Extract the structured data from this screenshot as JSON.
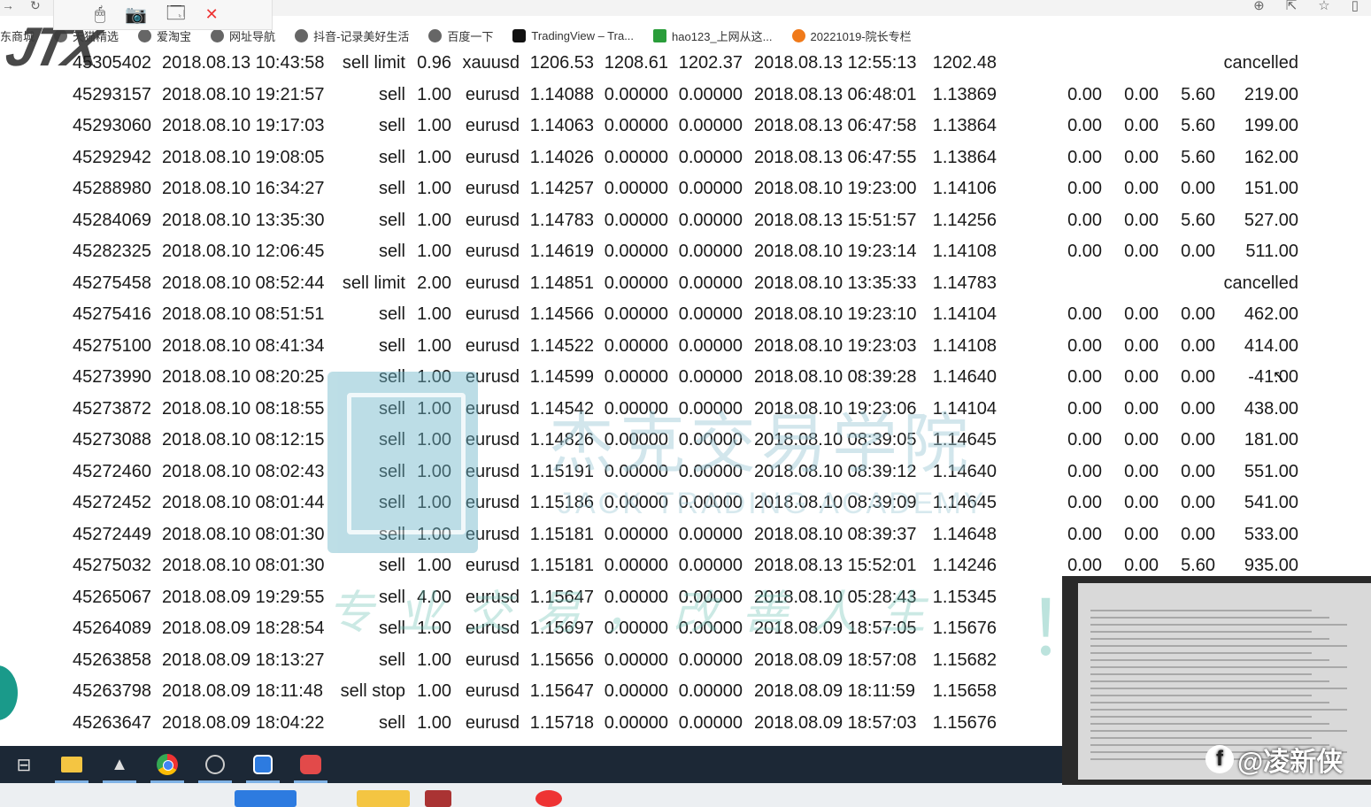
{
  "browser": {
    "bookmarks": [
      {
        "label": "东商城",
        "icon": "none"
      },
      {
        "label": "天猫精选",
        "icon": "globe-icon"
      },
      {
        "label": "爱淘宝",
        "icon": "globe-icon"
      },
      {
        "label": "网址导航",
        "icon": "globe-icon"
      },
      {
        "label": "抖音-记录美好生活",
        "icon": "globe-icon"
      },
      {
        "label": "百度一下",
        "icon": "globe-icon"
      },
      {
        "label": "TradingView – Tra...",
        "icon": "tradingview-icon"
      },
      {
        "label": "hao123_上网从这...",
        "icon": "hao123-icon"
      },
      {
        "label": "20221019-院长专栏",
        "icon": "orange-globe-icon"
      }
    ],
    "toolbar_close": "✕"
  },
  "logo": {
    "text": "JTX"
  },
  "table": {
    "rows": [
      {
        "ticket": "45305402",
        "open_time": "2018.08.13 10:43:58",
        "type": "sell limit",
        "size": "0.96",
        "item": "xauusd",
        "price": "1206.53",
        "sl": "1208.61",
        "tp": "1202.37",
        "close_time": "2018.08.13 12:55:13",
        "close_price": "1202.48",
        "commission": "",
        "taxes": "",
        "swap": "",
        "profit": "cancelled"
      },
      {
        "ticket": "45293157",
        "open_time": "2018.08.10 19:21:57",
        "type": "sell",
        "size": "1.00",
        "item": "eurusd",
        "price": "1.14088",
        "sl": "0.00000",
        "tp": "0.00000",
        "close_time": "2018.08.13 06:48:01",
        "close_price": "1.13869",
        "commission": "0.00",
        "taxes": "0.00",
        "swap": "5.60",
        "profit": "219.00"
      },
      {
        "ticket": "45293060",
        "open_time": "2018.08.10 19:17:03",
        "type": "sell",
        "size": "1.00",
        "item": "eurusd",
        "price": "1.14063",
        "sl": "0.00000",
        "tp": "0.00000",
        "close_time": "2018.08.13 06:47:58",
        "close_price": "1.13864",
        "commission": "0.00",
        "taxes": "0.00",
        "swap": "5.60",
        "profit": "199.00"
      },
      {
        "ticket": "45292942",
        "open_time": "2018.08.10 19:08:05",
        "type": "sell",
        "size": "1.00",
        "item": "eurusd",
        "price": "1.14026",
        "sl": "0.00000",
        "tp": "0.00000",
        "close_time": "2018.08.13 06:47:55",
        "close_price": "1.13864",
        "commission": "0.00",
        "taxes": "0.00",
        "swap": "5.60",
        "profit": "162.00"
      },
      {
        "ticket": "45288980",
        "open_time": "2018.08.10 16:34:27",
        "type": "sell",
        "size": "1.00",
        "item": "eurusd",
        "price": "1.14257",
        "sl": "0.00000",
        "tp": "0.00000",
        "close_time": "2018.08.10 19:23:00",
        "close_price": "1.14106",
        "commission": "0.00",
        "taxes": "0.00",
        "swap": "0.00",
        "profit": "151.00"
      },
      {
        "ticket": "45284069",
        "open_time": "2018.08.10 13:35:30",
        "type": "sell",
        "size": "1.00",
        "item": "eurusd",
        "price": "1.14783",
        "sl": "0.00000",
        "tp": "0.00000",
        "close_time": "2018.08.13 15:51:57",
        "close_price": "1.14256",
        "commission": "0.00",
        "taxes": "0.00",
        "swap": "5.60",
        "profit": "527.00"
      },
      {
        "ticket": "45282325",
        "open_time": "2018.08.10 12:06:45",
        "type": "sell",
        "size": "1.00",
        "item": "eurusd",
        "price": "1.14619",
        "sl": "0.00000",
        "tp": "0.00000",
        "close_time": "2018.08.10 19:23:14",
        "close_price": "1.14108",
        "commission": "0.00",
        "taxes": "0.00",
        "swap": "0.00",
        "profit": "511.00"
      },
      {
        "ticket": "45275458",
        "open_time": "2018.08.10 08:52:44",
        "type": "sell limit",
        "size": "2.00",
        "item": "eurusd",
        "price": "1.14851",
        "sl": "0.00000",
        "tp": "0.00000",
        "close_time": "2018.08.10 13:35:33",
        "close_price": "1.14783",
        "commission": "",
        "taxes": "",
        "swap": "",
        "profit": "cancelled"
      },
      {
        "ticket": "45275416",
        "open_time": "2018.08.10 08:51:51",
        "type": "sell",
        "size": "1.00",
        "item": "eurusd",
        "price": "1.14566",
        "sl": "0.00000",
        "tp": "0.00000",
        "close_time": "2018.08.10 19:23:10",
        "close_price": "1.14104",
        "commission": "0.00",
        "taxes": "0.00",
        "swap": "0.00",
        "profit": "462.00"
      },
      {
        "ticket": "45275100",
        "open_time": "2018.08.10 08:41:34",
        "type": "sell",
        "size": "1.00",
        "item": "eurusd",
        "price": "1.14522",
        "sl": "0.00000",
        "tp": "0.00000",
        "close_time": "2018.08.10 19:23:03",
        "close_price": "1.14108",
        "commission": "0.00",
        "taxes": "0.00",
        "swap": "0.00",
        "profit": "414.00"
      },
      {
        "ticket": "45273990",
        "open_time": "2018.08.10 08:20:25",
        "type": "sell",
        "size": "1.00",
        "item": "eurusd",
        "price": "1.14599",
        "sl": "0.00000",
        "tp": "0.00000",
        "close_time": "2018.08.10 08:39:28",
        "close_price": "1.14640",
        "commission": "0.00",
        "taxes": "0.00",
        "swap": "0.00",
        "profit": "-41.00"
      },
      {
        "ticket": "45273872",
        "open_time": "2018.08.10 08:18:55",
        "type": "sell",
        "size": "1.00",
        "item": "eurusd",
        "price": "1.14542",
        "sl": "0.00000",
        "tp": "0.00000",
        "close_time": "2018.08.10 19:23:06",
        "close_price": "1.14104",
        "commission": "0.00",
        "taxes": "0.00",
        "swap": "0.00",
        "profit": "438.00"
      },
      {
        "ticket": "45273088",
        "open_time": "2018.08.10 08:12:15",
        "type": "sell",
        "size": "1.00",
        "item": "eurusd",
        "price": "1.14826",
        "sl": "0.00000",
        "tp": "0.00000",
        "close_time": "2018.08.10 08:39:05",
        "close_price": "1.14645",
        "commission": "0.00",
        "taxes": "0.00",
        "swap": "0.00",
        "profit": "181.00"
      },
      {
        "ticket": "45272460",
        "open_time": "2018.08.10 08:02:43",
        "type": "sell",
        "size": "1.00",
        "item": "eurusd",
        "price": "1.15191",
        "sl": "0.00000",
        "tp": "0.00000",
        "close_time": "2018.08.10 08:39:12",
        "close_price": "1.14640",
        "commission": "0.00",
        "taxes": "0.00",
        "swap": "0.00",
        "profit": "551.00"
      },
      {
        "ticket": "45272452",
        "open_time": "2018.08.10 08:01:44",
        "type": "sell",
        "size": "1.00",
        "item": "eurusd",
        "price": "1.15186",
        "sl": "0.00000",
        "tp": "0.00000",
        "close_time": "2018.08.10 08:39:09",
        "close_price": "1.14645",
        "commission": "0.00",
        "taxes": "0.00",
        "swap": "0.00",
        "profit": "541.00"
      },
      {
        "ticket": "45272449",
        "open_time": "2018.08.10 08:01:30",
        "type": "sell",
        "size": "1.00",
        "item": "eurusd",
        "price": "1.15181",
        "sl": "0.00000",
        "tp": "0.00000",
        "close_time": "2018.08.10 08:39:37",
        "close_price": "1.14648",
        "commission": "0.00",
        "taxes": "0.00",
        "swap": "0.00",
        "profit": "533.00"
      },
      {
        "ticket": "45275032",
        "open_time": "2018.08.10 08:01:30",
        "type": "sell",
        "size": "1.00",
        "item": "eurusd",
        "price": "1.15181",
        "sl": "0.00000",
        "tp": "0.00000",
        "close_time": "2018.08.13 15:52:01",
        "close_price": "1.14246",
        "commission": "0.00",
        "taxes": "0.00",
        "swap": "5.60",
        "profit": "935.00"
      },
      {
        "ticket": "45265067",
        "open_time": "2018.08.09 19:29:55",
        "type": "sell",
        "size": "4.00",
        "item": "eurusd",
        "price": "1.15647",
        "sl": "0.00000",
        "tp": "0.00000",
        "close_time": "2018.08.10 05:28:43",
        "close_price": "1.15345",
        "commission": "",
        "taxes": "",
        "swap": "",
        "profit": ""
      },
      {
        "ticket": "45264089",
        "open_time": "2018.08.09 18:28:54",
        "type": "sell",
        "size": "1.00",
        "item": "eurusd",
        "price": "1.15697",
        "sl": "0.00000",
        "tp": "0.00000",
        "close_time": "2018.08.09 18:57:05",
        "close_price": "1.15676",
        "commission": "",
        "taxes": "",
        "swap": "",
        "profit": ""
      },
      {
        "ticket": "45263858",
        "open_time": "2018.08.09 18:13:27",
        "type": "sell",
        "size": "1.00",
        "item": "eurusd",
        "price": "1.15656",
        "sl": "0.00000",
        "tp": "0.00000",
        "close_time": "2018.08.09 18:57:08",
        "close_price": "1.15682",
        "commission": "",
        "taxes": "",
        "swap": "",
        "profit": ""
      },
      {
        "ticket": "45263798",
        "open_time": "2018.08.09 18:11:48",
        "type": "sell stop",
        "size": "1.00",
        "item": "eurusd",
        "price": "1.15647",
        "sl": "0.00000",
        "tp": "0.00000",
        "close_time": "2018.08.09 18:11:59",
        "close_price": "1.15658",
        "commission": "",
        "taxes": "",
        "swap": "",
        "profit": ""
      },
      {
        "ticket": "45263647",
        "open_time": "2018.08.09 18:04:22",
        "type": "sell",
        "size": "1.00",
        "item": "eurusd",
        "price": "1.15718",
        "sl": "0.00000",
        "tp": "0.00000",
        "close_time": "2018.08.09 18:57:03",
        "close_price": "1.15676",
        "commission": "",
        "taxes": "",
        "swap": "",
        "profit": ""
      }
    ]
  },
  "watermark": {
    "cn_name": "杰克交易学院",
    "en_name": "JACK TRADING ACADEMY",
    "slogan": "专业交易，改善人生",
    "exclaim": "！"
  },
  "taskbar": {
    "apps": [
      {
        "name": "task-view-icon",
        "glyph": "⊟"
      },
      {
        "name": "file-explorer-icon",
        "glyph": ""
      },
      {
        "name": "app-icon",
        "glyph": "▲"
      },
      {
        "name": "chrome-icon",
        "glyph": ""
      },
      {
        "name": "obs-icon",
        "glyph": ""
      },
      {
        "name": "browser-blue-icon",
        "glyph": ""
      },
      {
        "name": "red-app-icon",
        "glyph": ""
      }
    ]
  },
  "overlay": {
    "handle": "@凌新侠",
    "platform_glyph": "f"
  }
}
